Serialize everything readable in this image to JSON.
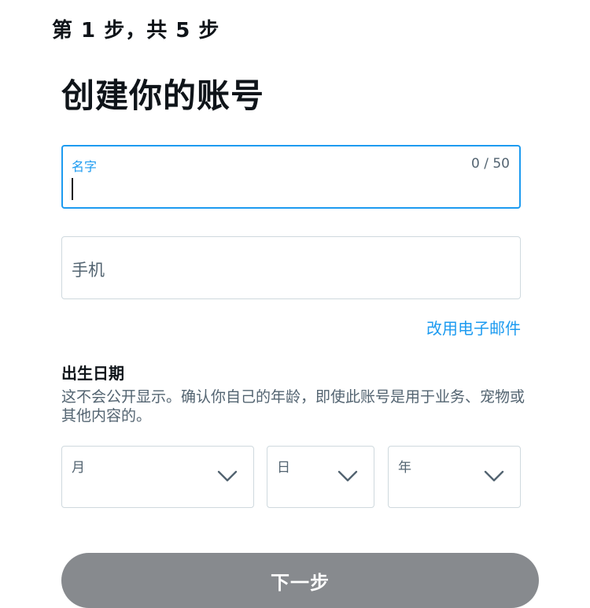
{
  "header": {
    "step_text": "第 1 步，共 5 步",
    "title": "创建你的账号"
  },
  "name_field": {
    "label": "名字",
    "counter": "0 / 50",
    "value": ""
  },
  "phone_field": {
    "placeholder": "手机"
  },
  "email_link": "改用电子邮件",
  "dob": {
    "heading": "出生日期",
    "description": "这不会公开显示。确认你自己的年龄，即使此账号是用于业务、宠物或其他内容的。",
    "month_label": "月",
    "day_label": "日",
    "year_label": "年"
  },
  "next_button": "下一步",
  "colors": {
    "accent": "#1d9bf0",
    "border": "#cfd9de",
    "button_disabled": "#878a8e",
    "muted_text": "#536471",
    "text": "#0f1419"
  },
  "icons": {
    "dropdown": "chevron-down-icon"
  }
}
